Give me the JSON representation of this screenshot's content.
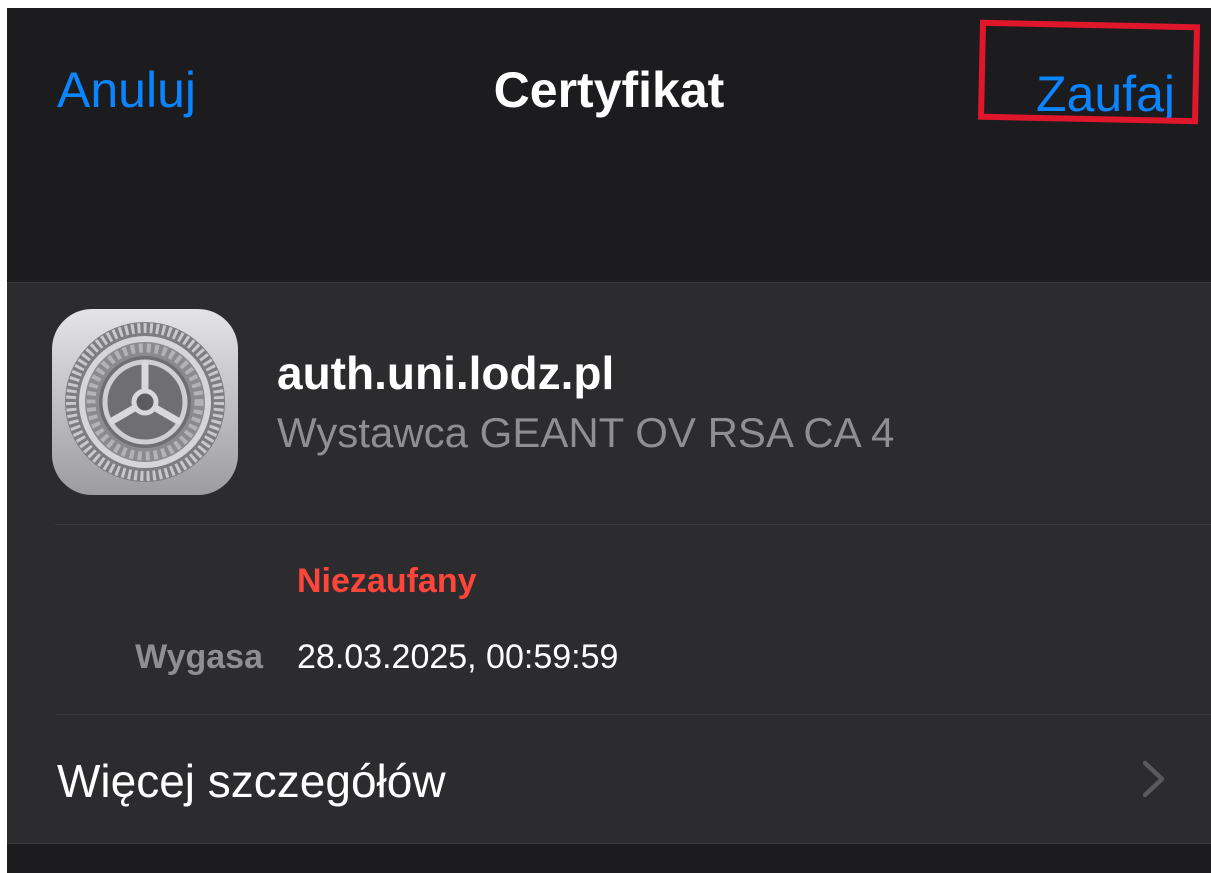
{
  "navbar": {
    "cancel_label": "Anuluj",
    "title": "Certyfikat",
    "trust_label": "Zaufaj"
  },
  "certificate": {
    "name": "auth.uni.lodz.pl",
    "issuer": "Wystawca GEANT OV RSA CA 4",
    "status": "Niezaufany",
    "expires_label": "Wygasa",
    "expires_value": "28.03.2025, 00:59:59"
  },
  "more_details": {
    "label": "Więcej szczegółów"
  },
  "icons": {
    "settings": "gear-icon",
    "chevron": "chevron-right-icon"
  },
  "colors": {
    "accent": "#0a84ff",
    "untrusted": "#ff453a",
    "highlight": "#e0162b",
    "background": "#1c1c1e",
    "card": "#2c2c2e"
  }
}
